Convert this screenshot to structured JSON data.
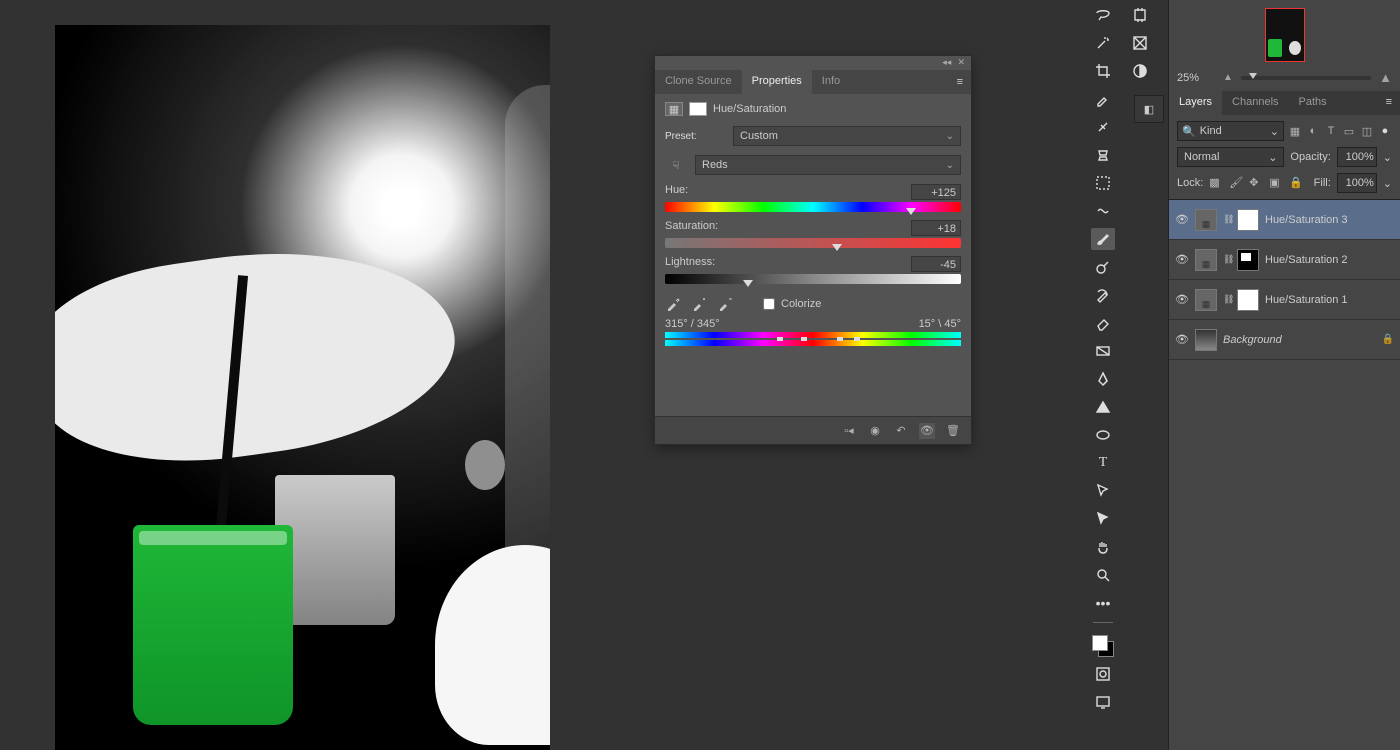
{
  "panel": {
    "tabs": {
      "clone": "Clone Source",
      "properties": "Properties",
      "info": "Info"
    },
    "adjustment_name": "Hue/Saturation",
    "preset_label": "Preset:",
    "preset_value": "Custom",
    "channel_value": "Reds",
    "hue": {
      "label": "Hue:",
      "value": "+125",
      "pos": 83
    },
    "saturation": {
      "label": "Saturation:",
      "value": "+18",
      "pos": 58
    },
    "lightness": {
      "label": "Lightness:",
      "value": "-45",
      "pos": 28
    },
    "colorize_label": "Colorize",
    "range_left": "315° / 345°",
    "range_right": "15° \\ 45°"
  },
  "navigator": {
    "zoom": "25%"
  },
  "layers": {
    "tabs": {
      "layers": "Layers",
      "channels": "Channels",
      "paths": "Paths"
    },
    "kind_label": "Kind",
    "blend_mode": "Normal",
    "opacity_label": "Opacity:",
    "opacity_value": "100%",
    "lock_label": "Lock:",
    "fill_label": "Fill:",
    "fill_value": "100%",
    "items": [
      {
        "name": "Hue/Saturation 3",
        "selected": true,
        "mask": "white",
        "locked": false
      },
      {
        "name": "Hue/Saturation 2",
        "selected": false,
        "mask": "shape",
        "locked": false
      },
      {
        "name": "Hue/Saturation 1",
        "selected": false,
        "mask": "white",
        "locked": false
      }
    ],
    "background_name": "Background"
  }
}
